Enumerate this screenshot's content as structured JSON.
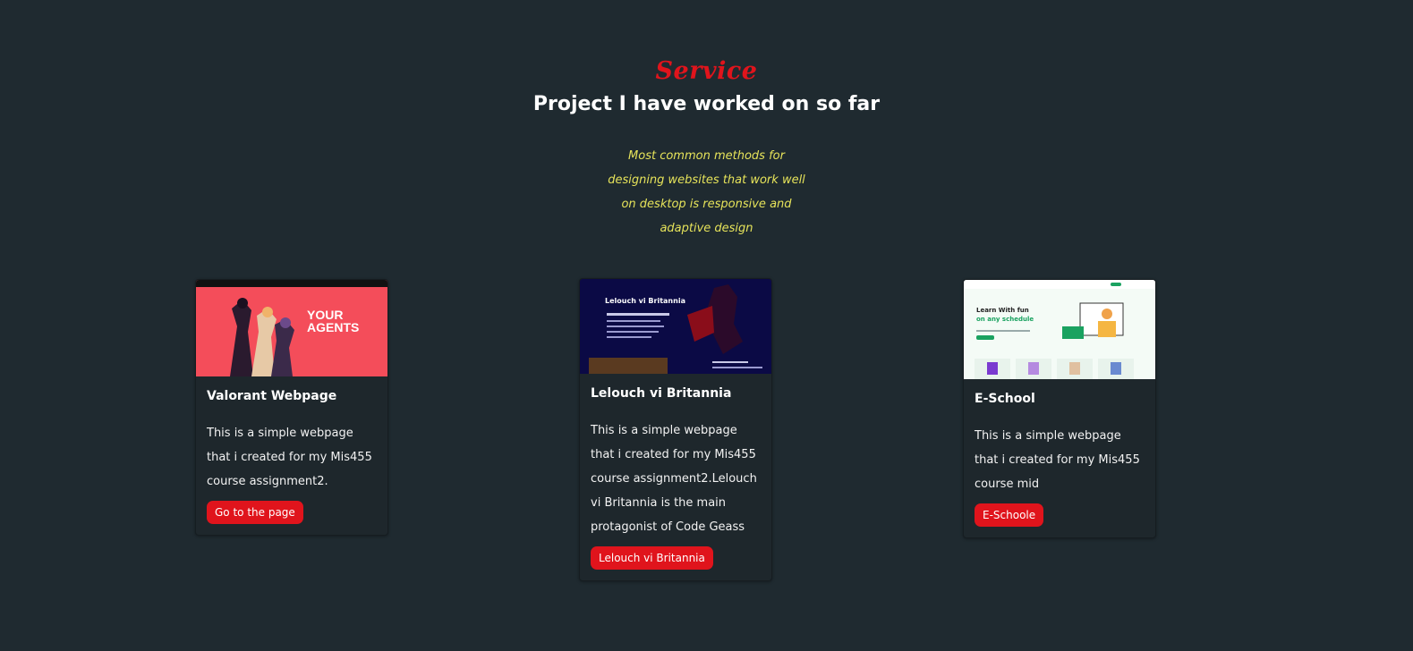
{
  "section": {
    "kicker": "Service",
    "heading": "Project I have worked on so far",
    "tagline": "Most common methods for designing websites that work well on desktop is responsive and adaptive design"
  },
  "colors": {
    "background": "#1f2a30",
    "accent": "#e0141c",
    "tagline": "#e6e35a",
    "card": "#1e272c"
  },
  "cards": [
    {
      "title": "Valorant Webpage",
      "description": "This is a simple webpage that i created for my Mis455 course assignment2.",
      "button": "Go to the page",
      "thumbnail": {
        "heading": "YOUR AGENTS"
      }
    },
    {
      "title": "Lelouch vi Britannia",
      "description": "This is a simple webpage that i created for my Mis455 course assignment2.Lelouch vi Britannia is the main protagonist of Code Geass",
      "button": "Lelouch vi Britannia",
      "thumbnail": {
        "heading": "Lelouch vi Britannia"
      }
    },
    {
      "title": "E-School",
      "description": "This is a simple webpage that i created for my Mis455 course mid",
      "button": "E-Schoole",
      "thumbnail": {
        "heading_line1": "Learn With fun",
        "heading_line2": "on any schedule"
      }
    }
  ]
}
